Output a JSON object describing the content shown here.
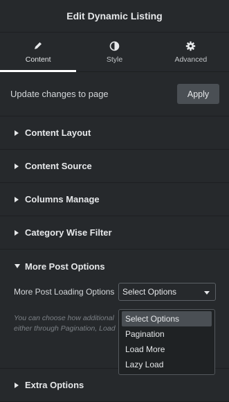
{
  "header": {
    "title": "Edit Dynamic Listing"
  },
  "tabs": [
    {
      "label": "Content",
      "icon": "pencil-icon",
      "active": true
    },
    {
      "label": "Style",
      "icon": "contrast-icon",
      "active": false
    },
    {
      "label": "Advanced",
      "icon": "gear-icon",
      "active": false
    }
  ],
  "update": {
    "text": "Update changes to page",
    "button_label": "Apply"
  },
  "sections": [
    {
      "title": "Content Layout"
    },
    {
      "title": "Content Source"
    },
    {
      "title": "Columns Manage"
    },
    {
      "title": "Category Wise Filter"
    }
  ],
  "open_section": {
    "title": "More Post Options",
    "field_label": "More Post Loading Options",
    "select_value": "Select Options",
    "help_line1": "You can choose how additional",
    "help_line2": "either through Pagination, Load"
  },
  "dropdown": {
    "options": [
      "Select Options",
      "Pagination",
      "Load More",
      "Lazy Load"
    ],
    "selected_index": 0
  },
  "last_section": {
    "title": "Extra Options"
  },
  "colors": {
    "background": "#26292c",
    "divider": "#1d1f21",
    "button": "#4a4f54",
    "text": "#e6e8ea"
  }
}
